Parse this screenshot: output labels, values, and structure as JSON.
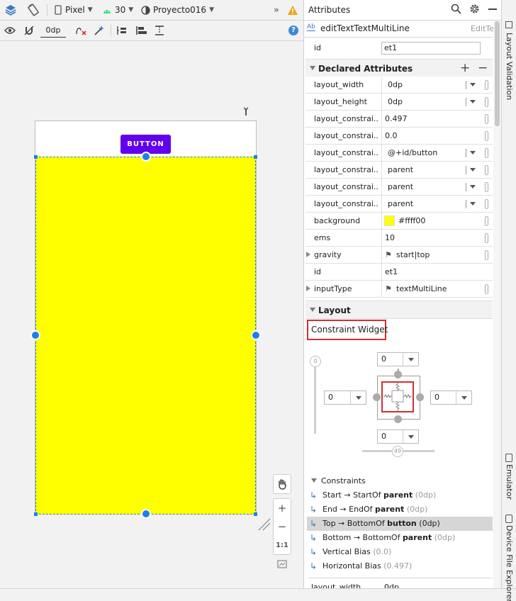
{
  "toolbar": {
    "device": "Pixel",
    "api_level": "30",
    "theme": "Proyecto016",
    "more": "»",
    "margin_default": "0dp"
  },
  "canvas": {
    "button_label": "BUTTON",
    "edittext_color": "#ffff00",
    "button_color": "#6200ee",
    "zoom_fit": "1:1"
  },
  "attributes": {
    "panel_title": "Attributes",
    "widget_icon_text": "Ab",
    "component_name": "editTextTextMultiLine",
    "component_type": "EditText",
    "id_label": "id",
    "id_value": "et1",
    "declared_section": "Declared Attributes",
    "add_symbol": "+",
    "remove_symbol": "−",
    "rows": [
      {
        "key": "layout_width",
        "value": "0dp",
        "type": "dropdown"
      },
      {
        "key": "layout_height",
        "value": "0dp",
        "type": "dropdown"
      },
      {
        "key": "layout_constrai...",
        "value": "0.497",
        "type": "text"
      },
      {
        "key": "layout_constrai...",
        "value": "0.0",
        "type": "text"
      },
      {
        "key": "layout_constrai...",
        "value": "@+id/button",
        "type": "dropdown"
      },
      {
        "key": "layout_constrai...",
        "value": "parent",
        "type": "dropdown"
      },
      {
        "key": "layout_constrai...",
        "value": "parent",
        "type": "dropdown"
      },
      {
        "key": "layout_constrai...",
        "value": "parent",
        "type": "dropdown"
      },
      {
        "key": "background",
        "value": "#ffff00",
        "type": "color"
      },
      {
        "key": "ems",
        "value": "10",
        "type": "text"
      },
      {
        "key": "gravity",
        "value": "start|top",
        "type": "flag"
      },
      {
        "key": "id",
        "value": "et1",
        "type": "text"
      },
      {
        "key": "inputType",
        "value": "textMultiLine",
        "type": "flag"
      }
    ],
    "layout_section": "Layout",
    "constraint_widget_label": "Constraint Widget",
    "margins": {
      "top": "0",
      "left": "0",
      "right": "0",
      "bottom": "0"
    },
    "vertical_bias_slider": "0",
    "horizontal_bias_slider": "49",
    "constraints_title": "Constraints",
    "constraints": [
      {
        "a": "Start → StartOf ",
        "b": "parent",
        "c": " (0dp)"
      },
      {
        "a": "End → EndOf ",
        "b": "parent",
        "c": " (0dp)"
      },
      {
        "a": "Top → BottomOf ",
        "b": "button",
        "c": " (0dp)"
      },
      {
        "a": "Bottom → BottomOf ",
        "b": "parent",
        "c": " (0dp)"
      },
      {
        "a": "Vertical Bias ",
        "b": "",
        "c": "(0.0)"
      },
      {
        "a": "Horizontal Bias ",
        "b": "",
        "c": "(0.497)"
      }
    ],
    "bottom_row_key": "layout_width",
    "bottom_row_value": "0dp"
  },
  "side_tabs": {
    "layout_validation": "Layout Validation",
    "emulator": "Emulator",
    "device_file_explorer": "Device File Explorer"
  },
  "colors": {
    "accent": "#1a80e8",
    "highlight": "#d6d6d6",
    "red_box": "#d32f2f"
  }
}
